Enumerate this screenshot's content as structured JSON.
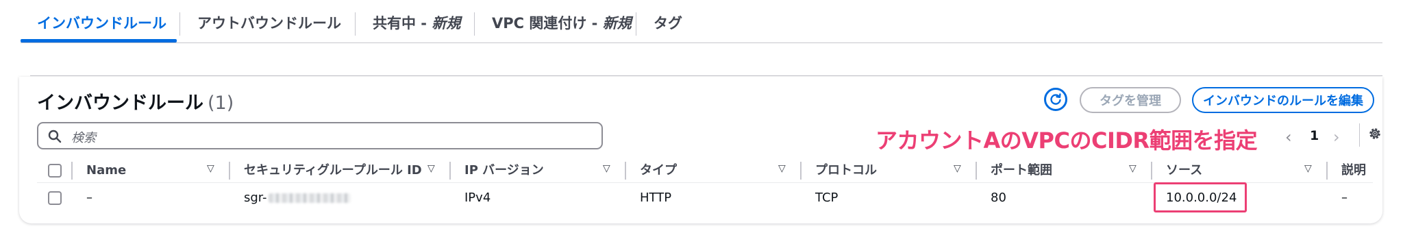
{
  "tabs": [
    {
      "label": "インバウンドルール"
    },
    {
      "label": "アウトバウンドルール"
    },
    {
      "label": "共有中 - ",
      "suffix": "新規"
    },
    {
      "label": "VPC 関連付け - ",
      "suffix": "新規"
    },
    {
      "label": "タグ"
    }
  ],
  "panel": {
    "title": "インバウンドルール",
    "count": "(1)",
    "manage_tags_label": "タグを管理",
    "edit_rules_label": "インバウンドのルールを編集",
    "search_placeholder": "検索",
    "annotation": "アカウントAのVPCのCIDR範囲を指定",
    "pagination": {
      "current": "1"
    }
  },
  "table": {
    "columns": [
      "Name",
      "セキュリティグループルール ID",
      "IP バージョン",
      "タイプ",
      "プロトコル",
      "ポート範囲",
      "ソース",
      "説明"
    ],
    "rows": [
      {
        "name": "–",
        "rule_id": "sgr-",
        "ip_version": "IPv4",
        "type": "HTTP",
        "protocol": "TCP",
        "port_range": "80",
        "source": "10.0.0.0/24",
        "description": "–"
      }
    ]
  },
  "colors": {
    "accent": "#006ce0",
    "annotation": "#ec3f74"
  }
}
